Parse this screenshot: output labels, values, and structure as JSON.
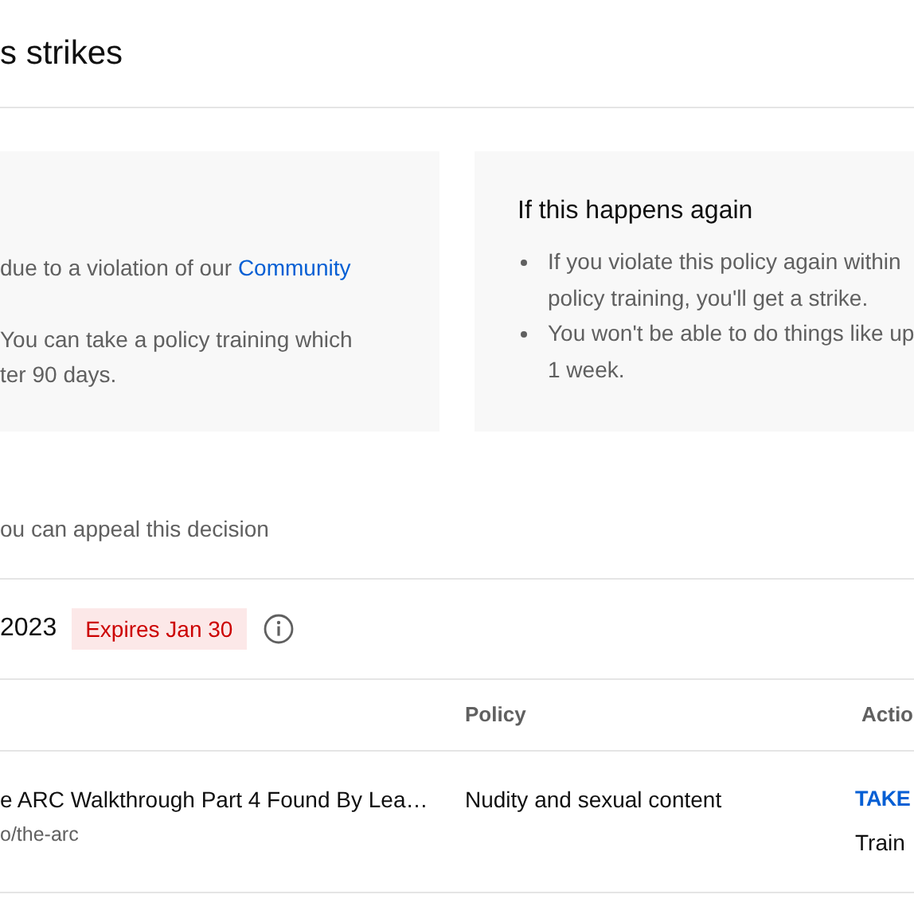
{
  "header": {
    "title": "s strikes"
  },
  "cards": [
    {
      "kind": "paragraphs",
      "paragraphs": [
        {
          "lines": [
            "due to a violation of our "
          ],
          "link": "Community"
        },
        {
          "lines": [
            "You can take a policy training which",
            "ter 90 days."
          ]
        }
      ]
    },
    {
      "kind": "bullets",
      "title": "If this happens again",
      "bullets": [
        {
          "lines": [
            "If you violate this policy again within",
            "policy training, you'll get a strike."
          ]
        },
        {
          "lines": [
            "You won't be able to do things like up",
            "1 week."
          ]
        }
      ]
    }
  ],
  "appeal_text": "ou can appeal this decision",
  "strike": {
    "date": "2023",
    "badge": "Expires Jan 30"
  },
  "table": {
    "columns": [
      "Policy",
      "Actio"
    ],
    "rows": [
      {
        "video_title": "e ARC Walkthrough Part 4 Found By Lea…",
        "video_url": "o/the-arc",
        "policy": "Nudity and sexual content",
        "action_link": "TAKE",
        "action_note": "Train"
      }
    ]
  }
}
